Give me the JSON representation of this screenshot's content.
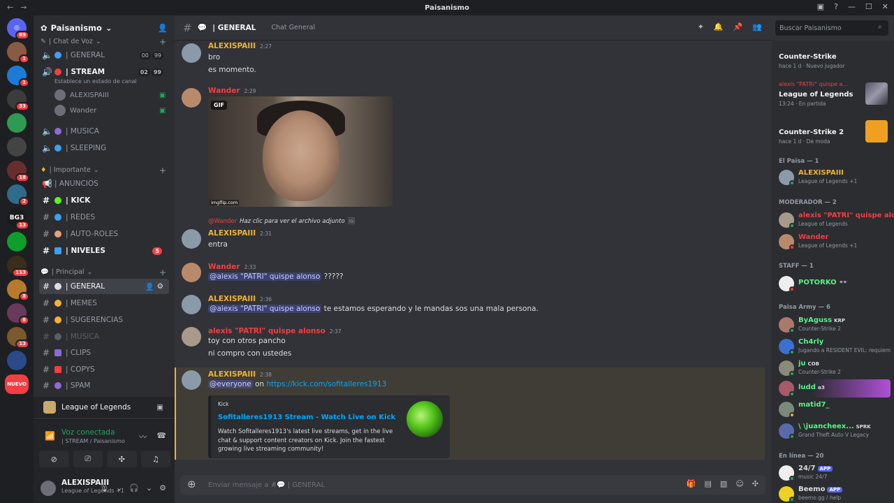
{
  "app": {
    "title": "Paisanismo"
  },
  "colors": {
    "accent": "#5865f2",
    "mention": "#c9cdfb",
    "gold": "#f0b232",
    "red": "#f23f43",
    "green": "#23a55a"
  },
  "servers": [
    {
      "badge": "69",
      "color": "#5865f2",
      "glyph": "◎"
    },
    {
      "badge": "1",
      "color": "#8a5a44",
      "glyph": ""
    },
    {
      "badge": "1",
      "color": "#1d7ad6",
      "glyph": ""
    },
    {
      "badge": "33",
      "color": "#3c3c3c",
      "glyph": ""
    },
    {
      "badge": "",
      "color": "#2d9b52",
      "glyph": ""
    },
    {
      "badge": "",
      "color": "#444",
      "glyph": ""
    },
    {
      "badge": "18",
      "color": "#6a2d2d",
      "glyph": ""
    },
    {
      "badge": "2",
      "color": "#2f6b8a",
      "glyph": ""
    },
    {
      "badge": "13",
      "color": "#1b1b1b",
      "glyph": "BG3"
    },
    {
      "badge": "",
      "color": "#0f9d2c",
      "glyph": ""
    },
    {
      "badge": "113",
      "color": "#3a2d1a",
      "glyph": ""
    },
    {
      "badge": "8",
      "color": "#b77a2a",
      "glyph": ""
    },
    {
      "badge": "6",
      "color": "#6a3a5a",
      "glyph": ""
    },
    {
      "badge": "13",
      "color": "#7a5a2a",
      "glyph": ""
    },
    {
      "badge": "",
      "color": "#2a4a8a",
      "glyph": ""
    },
    {
      "badge": "",
      "color": "#f23f43",
      "glyph": "NUEVO"
    }
  ],
  "guild": {
    "name": "Paisanismo"
  },
  "categories": {
    "voz": "| Chat de Voz",
    "importante": "| Importante",
    "principal": "| Principal"
  },
  "voice_channels": {
    "general": {
      "label": "| GENERAL",
      "c1": "00",
      "c2": "99"
    },
    "stream": {
      "label": "| STREAM",
      "c1": "02",
      "c2": "99",
      "status": "Establece un estado de canal"
    },
    "musica": {
      "label": "| MUSICA"
    },
    "sleeping": {
      "label": "| SLEEPING"
    }
  },
  "voice_users": [
    "ALEXISPAIII",
    "Wander"
  ],
  "text_channels": {
    "anuncios": "| ANUNCIOS",
    "kick": "| KICK",
    "redes": "| REDES",
    "autoroles": "| AUTO-ROLES",
    "niveles": "| NIVELES",
    "niveles_badge": "5",
    "general": "| GENERAL",
    "memes": "| MEMES",
    "sugerencias": "| SUGERENCIAS",
    "musica": "| MUSICA",
    "clips": "| CLIPS",
    "copys": "| COPYS",
    "spam": "| SPAM"
  },
  "activity": {
    "game": "League of Legends"
  },
  "voice_panel": {
    "title": "Voz conectada",
    "sub": "| STREAM / Paisanismo"
  },
  "user_panel": {
    "name": "ALEXISPAIII",
    "sub": "League of Legends +1"
  },
  "chat_header": {
    "channel": "| GENERAL",
    "topic": "Chat General"
  },
  "search": {
    "placeholder": "Buscar Paisanismo"
  },
  "messages": [
    {
      "author": "ALEXISPAIII",
      "time": "2:27",
      "lines": [
        "bro",
        "es momento."
      ]
    },
    {
      "author": "Wander",
      "time": "2:29",
      "gif_tag": "GIF",
      "gif_wm": "imgflip.com"
    },
    {
      "reply_user": "@Wander",
      "reply_text": "Haz clic para ver el archivo adjunto",
      "author": "ALEXISPAIII",
      "time": "2:31",
      "lines": [
        "entra"
      ]
    },
    {
      "author": "Wander",
      "time": "2:33",
      "mention": "@alexis \"PATRI\" quispe alonso",
      "after": "?????"
    },
    {
      "author": "ALEXISPAIII",
      "time": "2:36",
      "mention": "@alexis \"PATRI\" quispe alonso",
      "after": "te estamos esperando y le mandas sos una mala persona."
    },
    {
      "author": "alexis \"PATRI\" quispe alonso",
      "time": "2:37",
      "lines": [
        "toy con otros pancho",
        "ni compro con ustedes"
      ]
    },
    {
      "author": "ALEXISPAIII",
      "time": "2:38",
      "mention": "@everyone",
      "on": "on",
      "link": "https://kick.com/sofitalleres1913"
    }
  ],
  "embed": {
    "provider": "Kick",
    "title": "Sofitalleres1913 Stream - Watch Live on Kick",
    "desc": "Watch Sofitalleres1913's latest live streams, get in the live chat & support content creators on Kick. Join the fastest growing live streaming community!"
  },
  "composer": {
    "placeholder": "Enviar mensaje a #💬 | GENERAL"
  },
  "member_activity": [
    {
      "user": "",
      "game": "Counter-Strike",
      "sub": "hace 1 d  ·  Nuevo jugador"
    },
    {
      "user": "alexis \"PATRI\" quispe a...",
      "game": "League of Legends",
      "sub": "13:24  ·  En partida"
    },
    {
      "user": "",
      "game": "Counter-Strike 2",
      "sub": "hace 1 d  ·  De moda"
    }
  ],
  "member_groups": [
    {
      "title": "El Paisa — 1",
      "members": [
        {
          "name": "ALEXISPAIII",
          "sub": "League of Legends +1",
          "color": "#f0b232"
        }
      ]
    },
    {
      "title": "MODERADOR — 2",
      "members": [
        {
          "name": "alexis \"PATRI\" quispe alo...",
          "sub": "League of Legends",
          "color": "#f23f43"
        },
        {
          "name": "Wander",
          "sub": "League of Legends +1",
          "color": "#f23f43"
        }
      ]
    },
    {
      "title": "STAFF — 1",
      "members": [
        {
          "name": "POTORKO 👓",
          "sub": "",
          "color": "#57f287"
        }
      ]
    },
    {
      "title": "Paisa Army — 6",
      "members": [
        {
          "name": "ByAguss",
          "tag": "KRP",
          "sub": "Counter-Strike 2",
          "color": "#57f287"
        },
        {
          "name": "Ch4rly",
          "sub": "Jugando a RESIDENT EVIL: requiem",
          "color": "#57f287"
        },
        {
          "name": "ju",
          "tag": "COB",
          "sub": "Counter-Strike 2",
          "color": "#57f287"
        },
        {
          "name": "ludd",
          "tag": "ɞ3",
          "sub": "",
          "color": "#57f287"
        },
        {
          "name": "matid7_",
          "sub": "",
          "color": "#57f287"
        },
        {
          "name": "\\ \\juancheex...",
          "tag": "SPRK",
          "sub": "Grand Theft Auto V Legacy",
          "color": "#57f287"
        }
      ]
    },
    {
      "title": "En línea — 20",
      "members": [
        {
          "name": "24/7",
          "tag": "APP",
          "sub": "music 24/7",
          "color": "#dbdee1"
        },
        {
          "name": "Beemo",
          "tag": "APP",
          "sub": "beemo.gg / help",
          "color": "#dbdee1"
        }
      ]
    }
  ]
}
